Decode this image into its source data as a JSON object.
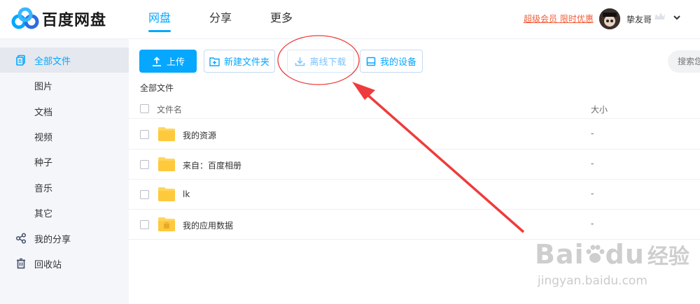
{
  "app": {
    "logo_text": "百度网盘"
  },
  "nav": {
    "items": [
      {
        "label": "网盘",
        "active": true
      },
      {
        "label": "分享"
      },
      {
        "label": "更多"
      }
    ]
  },
  "header": {
    "promo": "超级会员 限时优惠",
    "username": "挚友哥"
  },
  "sidebar": {
    "items": [
      {
        "label": "全部文件",
        "icon": "files-icon",
        "active": true
      },
      {
        "label": "图片"
      },
      {
        "label": "文档"
      },
      {
        "label": "视频"
      },
      {
        "label": "种子"
      },
      {
        "label": "音乐"
      },
      {
        "label": "其它"
      },
      {
        "label": "我的分享",
        "icon": "share-icon"
      },
      {
        "label": "回收站",
        "icon": "trash-icon"
      }
    ]
  },
  "toolbar": {
    "upload": "上传",
    "new_folder": "新建文件夹",
    "offline_download": "离线下载",
    "my_devices": "我的设备",
    "search_placeholder": "搜索您"
  },
  "breadcrumb": "全部文件",
  "table": {
    "col_name": "文件名",
    "col_size": "大小",
    "rows": [
      {
        "name": "我的资源",
        "size": "-"
      },
      {
        "name": "来自：百度相册",
        "size": "-"
      },
      {
        "name": "lk",
        "size": "-"
      },
      {
        "name": "我的应用数据",
        "size": "-"
      }
    ]
  },
  "watermark": {
    "brand": "Bai",
    "brand2": "du",
    "cn": "经验",
    "url": "jingyan.baidu.com"
  },
  "colors": {
    "accent": "#06a7ff",
    "annotation": "#ee3b3b",
    "promo": "#f25d37"
  }
}
